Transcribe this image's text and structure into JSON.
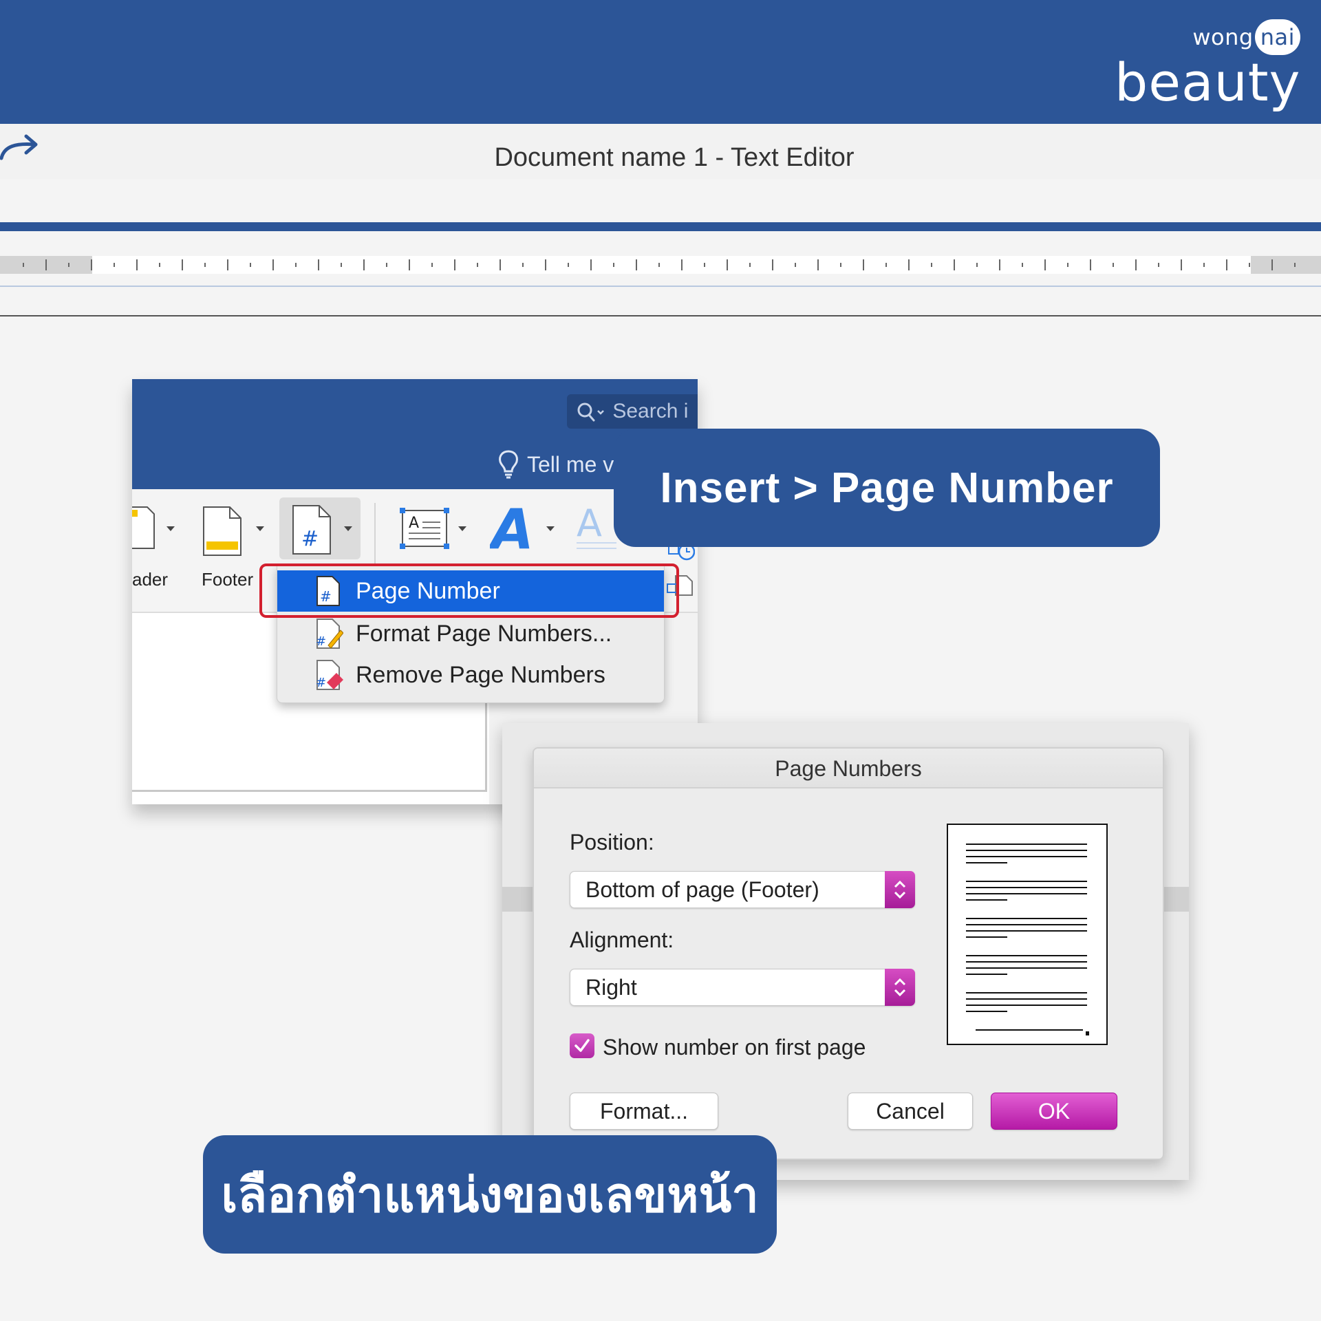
{
  "brand": {
    "prefix": "wong",
    "bubble": "nai",
    "name": "beauty"
  },
  "titlebar": {
    "title": "Document name 1 - Text Editor"
  },
  "ribbon": {
    "search_placeholder": "Search i",
    "tell_me": "Tell me v",
    "header_label": "ader",
    "footer_label": "Footer"
  },
  "menu": {
    "items": [
      {
        "label": "Page Number",
        "icon": "page-number-icon",
        "selected": true
      },
      {
        "label": "Format Page Numbers...",
        "icon": "format-page-numbers-icon",
        "selected": false
      },
      {
        "label": "Remove Page Numbers",
        "icon": "remove-page-numbers-icon",
        "selected": false
      }
    ]
  },
  "dialog": {
    "title": "Page Numbers",
    "position_label": "Position:",
    "position_value": "Bottom of page (Footer)",
    "alignment_label": "Alignment:",
    "alignment_value": "Right",
    "checkbox_label": "Show number on first page",
    "checkbox_checked": true,
    "format_button": "Format...",
    "cancel_button": "Cancel",
    "ok_button": "OK"
  },
  "callouts": {
    "step_insert": "Insert > Page Number",
    "step_position": "เลือกตำแหน่งของเลขหน้า"
  },
  "colors": {
    "brand_blue": "#2c5597",
    "menu_selected": "#1464dc",
    "highlight_red": "#d3202f",
    "accent_magenta": "#c02bb2"
  }
}
